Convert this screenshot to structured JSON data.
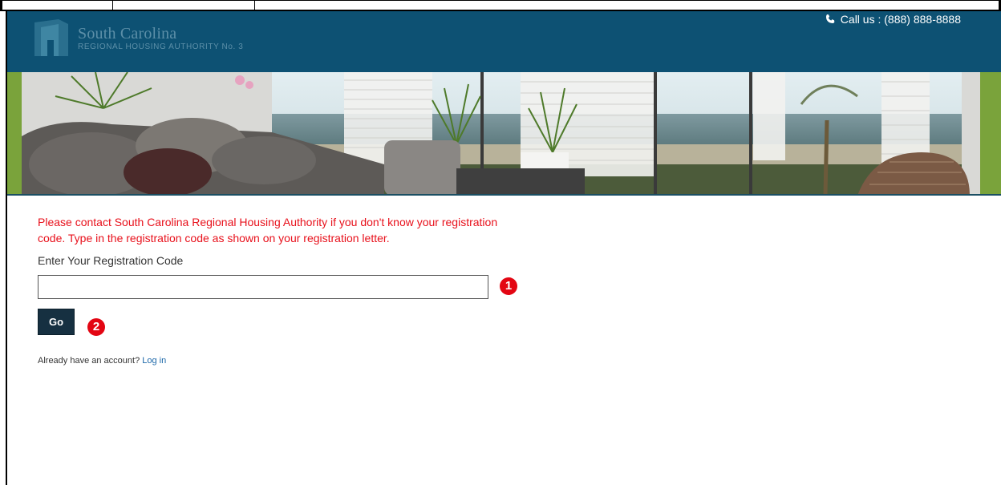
{
  "header": {
    "logo_title": "South Carolina",
    "logo_subtitle": "REGIONAL HOUSING AUTHORITY No. 3",
    "phone_text": "Call us : (888) 888-8888",
    "phone_icon": "phone-icon",
    "background_color": "#0d5173"
  },
  "hero": {
    "image": "living-room-ocean-view-banner"
  },
  "registration": {
    "notice": "Please contact South Carolina Regional Housing Authority if you don't know your registration code. Type in the registration code as shown on your registration letter.",
    "field_label": "Enter Your Registration Code",
    "input_value": "",
    "input_placeholder": "",
    "go_label": "Go",
    "marker_1": "1",
    "marker_2": "2"
  },
  "footer": {
    "account_prompt": "Already have an account?",
    "login_link": "Log in"
  },
  "colors": {
    "notice": "#e8101b",
    "button": "#163041",
    "link": "#1a66a8",
    "marker": "#e30613"
  }
}
